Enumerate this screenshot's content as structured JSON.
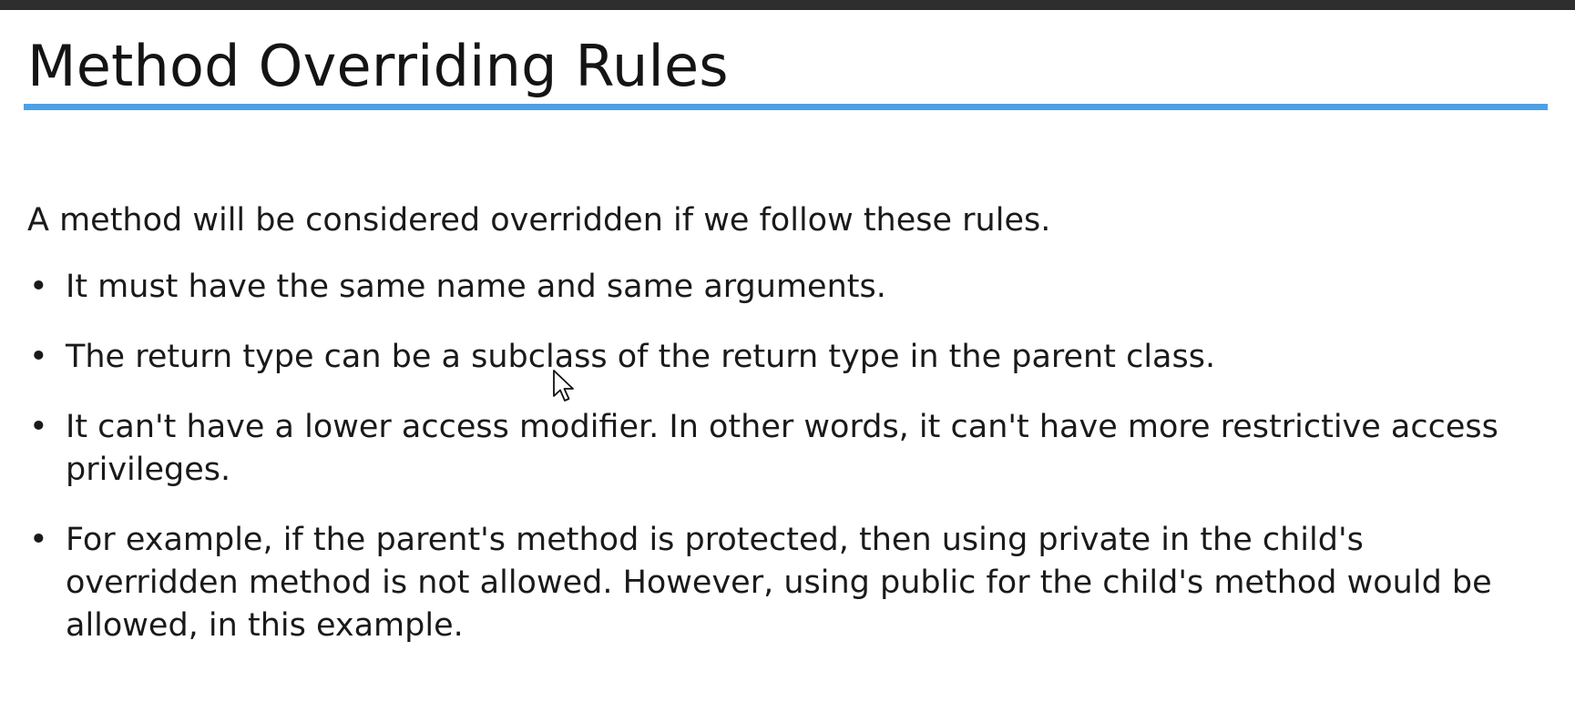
{
  "slide": {
    "title": "Method Overriding Rules",
    "intro": "A method will be considered overridden if we follow these rules.",
    "bullet_symbol": "•",
    "bullets": [
      {
        "text": "It must have the same name and same arguments."
      },
      {
        "text": "The return type can be a subclass of the return type in the parent class."
      },
      {
        "text": "It can't have a lower access modifier. In other words, it can't have more restrictive access privileges."
      },
      {
        "text": "For example, if the parent's method is protected, then using private in the child's overridden method is not allowed.  However, using public for the child's method would be allowed, in this example."
      }
    ]
  },
  "colors": {
    "title_rule": "#4ea0e6",
    "text": "#1a1a1a",
    "top_strip": "#2e2e2e",
    "background": "#ffffff"
  },
  "icons": {
    "cursor": "mouse-pointer-icon"
  }
}
